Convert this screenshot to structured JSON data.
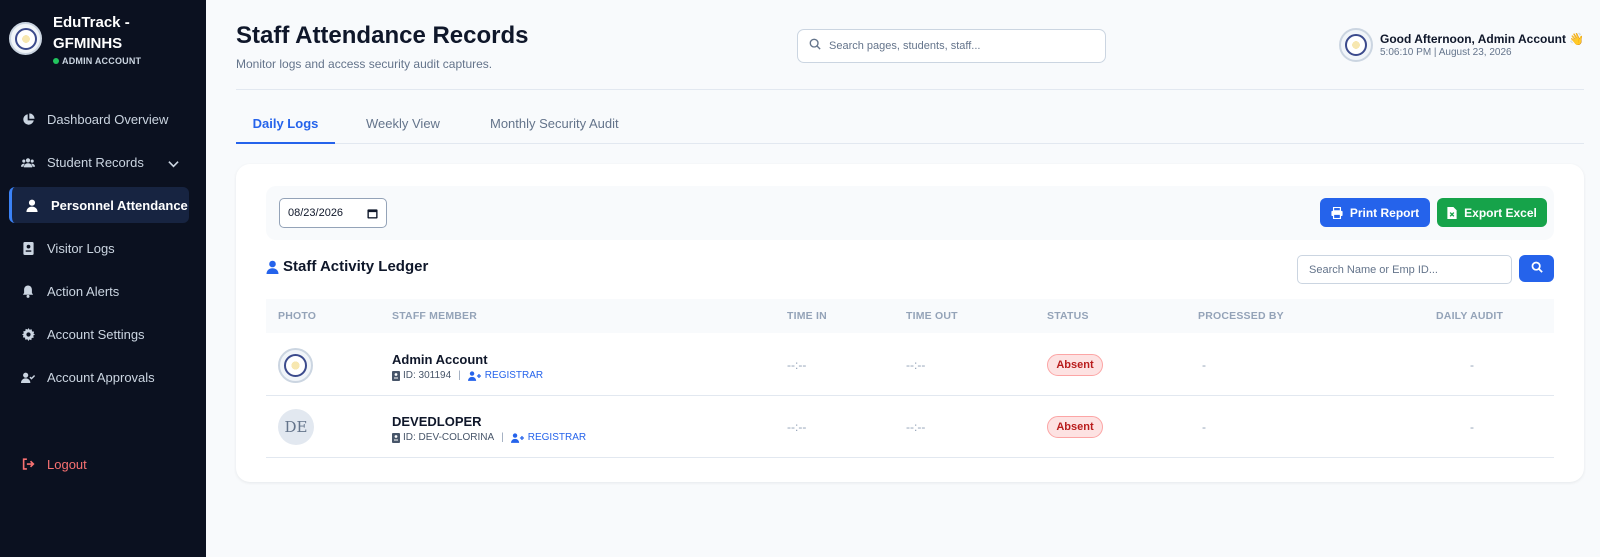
{
  "sidebar": {
    "brand_title": "EduTrack - GFMINHS",
    "brand_role": "ADMIN ACCOUNT",
    "items": [
      {
        "label": "Dashboard Overview",
        "icon": "pie-chart-icon"
      },
      {
        "label": "Student Records",
        "icon": "users-icon"
      },
      {
        "label": "Personnel Attendance",
        "icon": "user-icon"
      },
      {
        "label": "Visitor Logs",
        "icon": "id-card-icon"
      },
      {
        "label": "Action Alerts",
        "icon": "bell-icon"
      },
      {
        "label": "Account Settings",
        "icon": "gear-icon"
      },
      {
        "label": "Account Approvals",
        "icon": "user-check-icon"
      }
    ],
    "logout_label": "Logout",
    "active_item": "Personnel Attendance"
  },
  "header": {
    "title": "Staff Attendance Records",
    "subtitle": "Monitor logs and access security audit captures.",
    "search_placeholder": "Search pages, students, staff...",
    "greeting": "Good Afternoon, Admin Account 👋",
    "datetime": "5:06:10 PM | August 23, 2026"
  },
  "tabs": [
    {
      "label": "Daily Logs",
      "active": true
    },
    {
      "label": "Weekly View",
      "active": false
    },
    {
      "label": "Monthly Security Audit",
      "active": false
    }
  ],
  "toolbar": {
    "date_value": "08/23/2026",
    "print_label": "Print Report",
    "export_label": "Export Excel"
  },
  "ledger": {
    "title": "Staff Activity Ledger",
    "search_placeholder": "Search Name or Emp ID...",
    "columns": [
      "PHOTO",
      "STAFF MEMBER",
      "TIME IN",
      "TIME OUT",
      "STATUS",
      "PROCESSED BY",
      "DAILY AUDIT"
    ],
    "rows": [
      {
        "photo": "seal",
        "name": "Admin Account",
        "id": "ID: 301194",
        "role": "REGISTRAR",
        "time_in": "--:--",
        "time_out": "--:--",
        "status": "Absent",
        "processed_by": "-",
        "daily_audit": "-"
      },
      {
        "photo": "initials",
        "initials": "DE",
        "name": "DEVEDLOPER",
        "id": "ID: DEV-COLORINA",
        "role": "REGISTRAR",
        "time_in": "--:--",
        "time_out": "--:--",
        "status": "Absent",
        "processed_by": "-",
        "daily_audit": "-"
      }
    ]
  },
  "colors": {
    "sidebar_bg": "#0b1120",
    "accent": "#2563eb",
    "success": "#16a34a",
    "danger": "#b91c1c",
    "logout": "#f87171"
  }
}
